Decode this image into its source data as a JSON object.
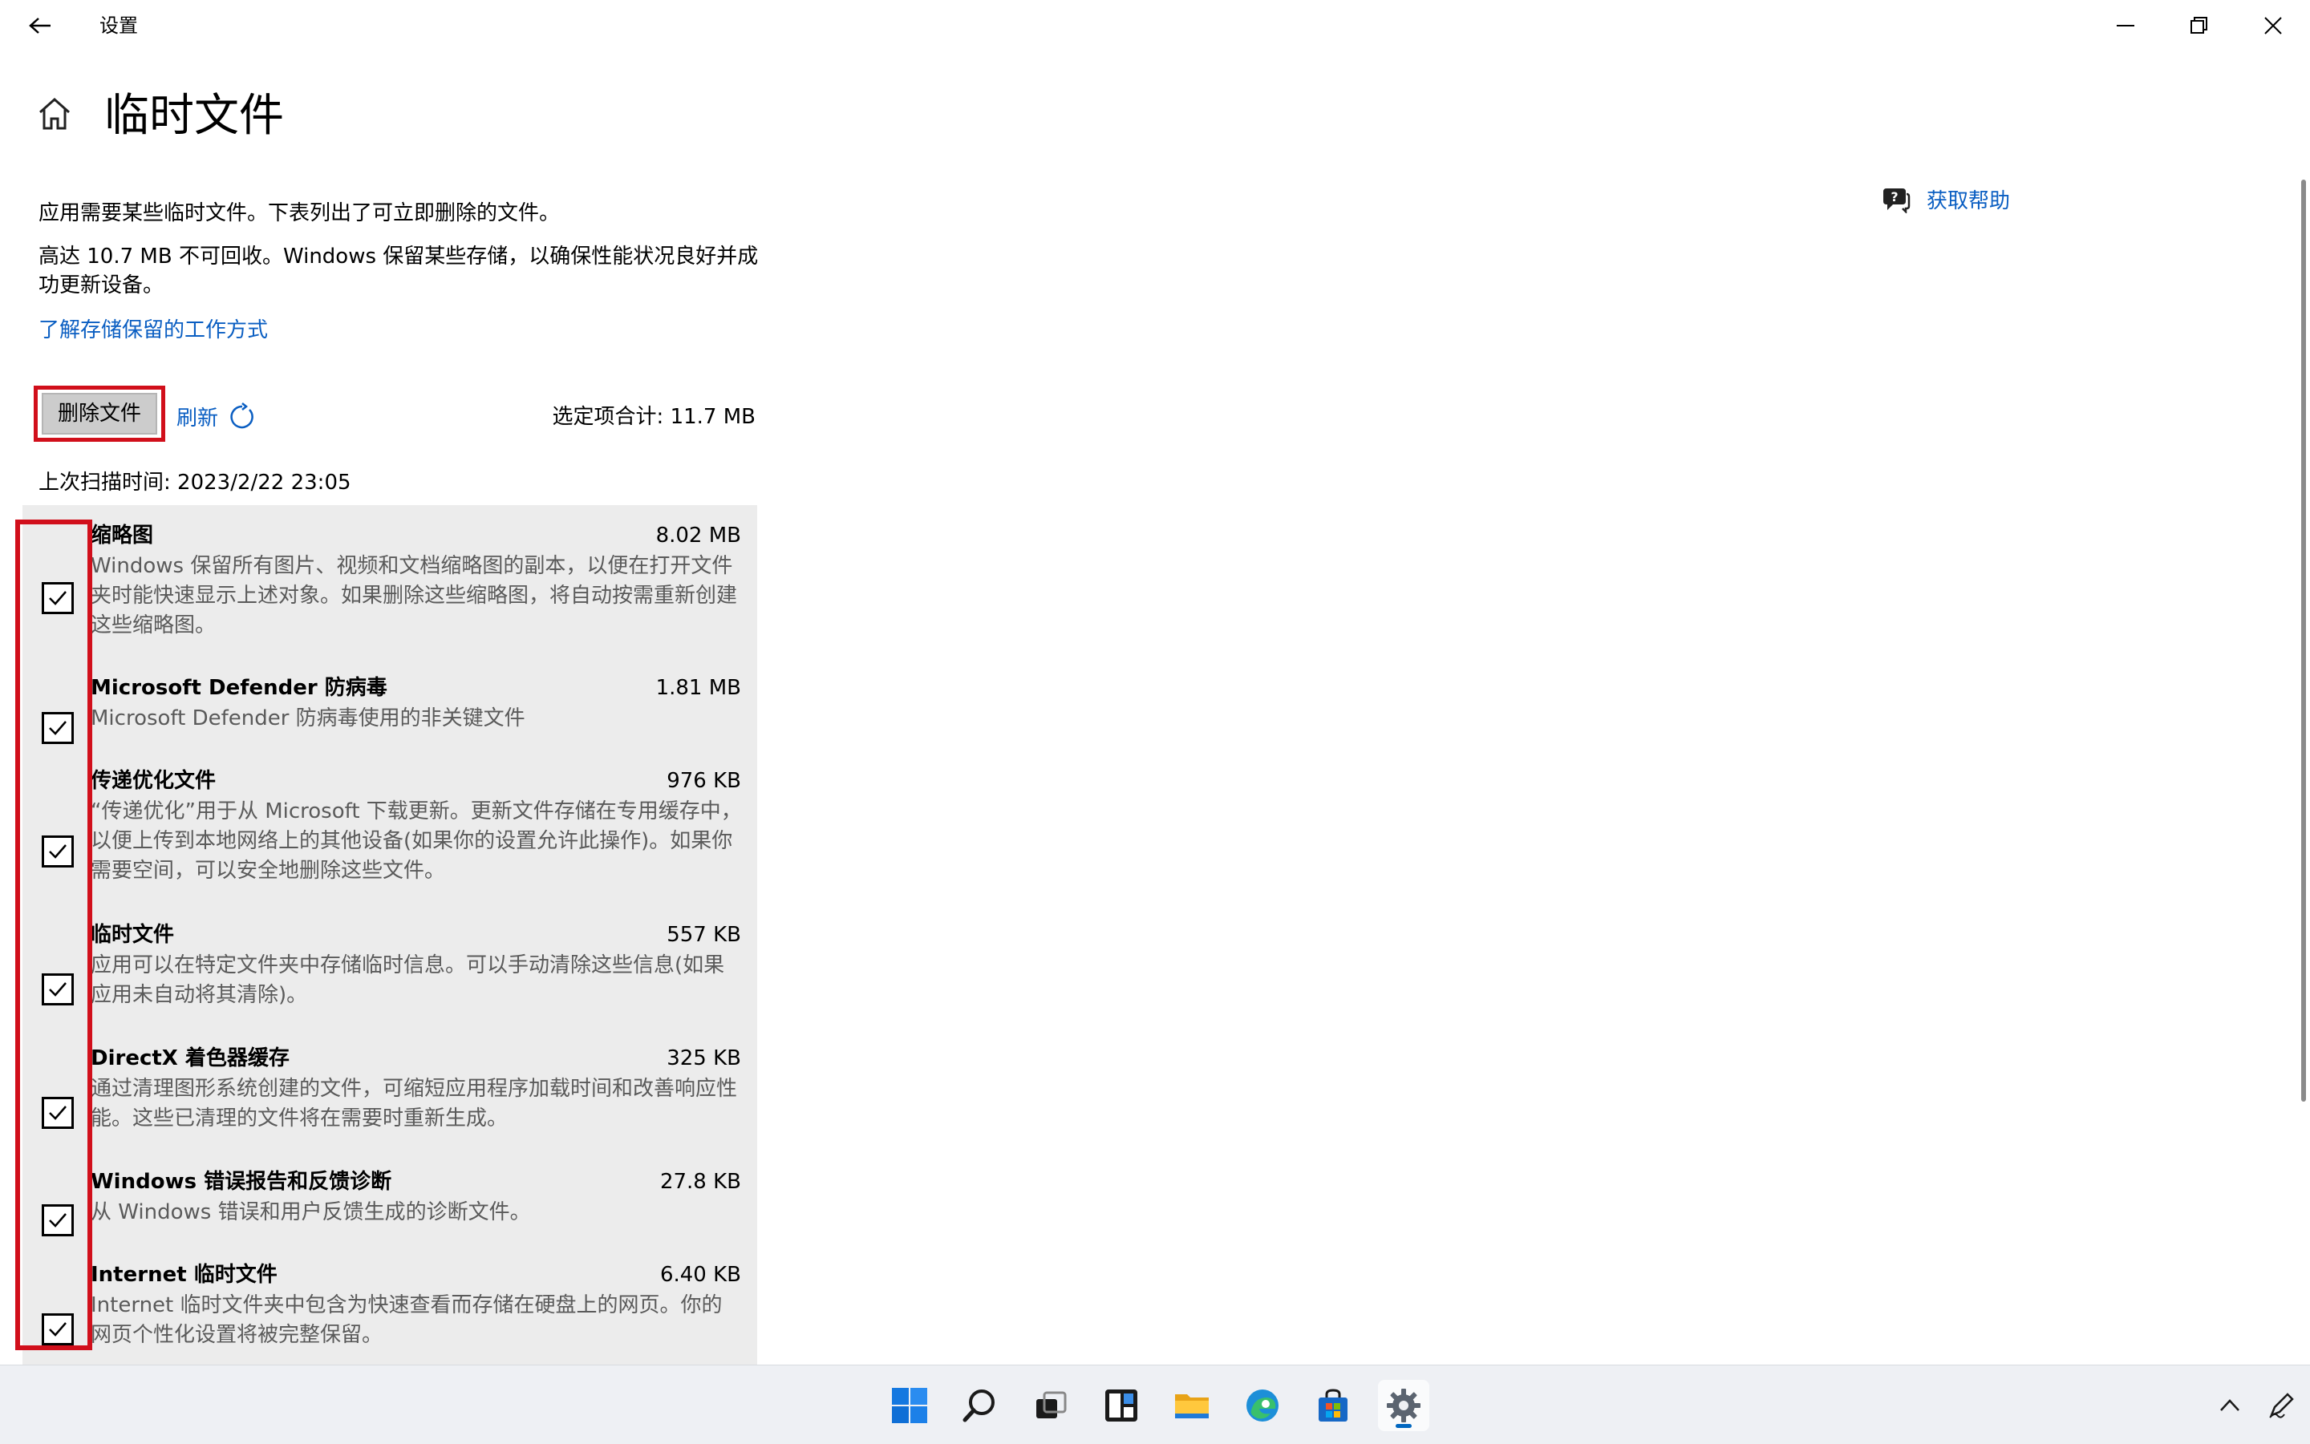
{
  "window": {
    "title": "设置"
  },
  "page": {
    "title": "临时文件",
    "help_label": "获取帮助",
    "description_1": "应用需要某些临时文件。下表列出了可立即删除的文件。",
    "description_2": "高达 10.7 MB 不可回收。Windows 保留某些存储，以确保性能状况良好并成功更新设备。",
    "learn_link": "了解存储保留的工作方式",
    "delete_button": "删除文件",
    "refresh_label": "刷新",
    "selected_total": "选定项合计: 11.7 MB",
    "last_scan": "上次扫描时间: 2023/2/22 23:05"
  },
  "items": [
    {
      "title": "缩略图",
      "size": "8.02 MB",
      "checked": true,
      "description": "Windows 保留所有图片、视频和文档缩略图的副本，以便在打开文件夹时能快速显示上述对象。如果删除这些缩略图，将自动按需重新创建这些缩略图。"
    },
    {
      "title": "Microsoft Defender 防病毒",
      "size": "1.81 MB",
      "checked": true,
      "description": "Microsoft Defender 防病毒使用的非关键文件"
    },
    {
      "title": "传递优化文件",
      "size": "976 KB",
      "checked": true,
      "description": "“传递优化”用于从 Microsoft 下载更新。更新文件存储在专用缓存中，以便上传到本地网络上的其他设备(如果你的设置允许此操作)。如果你需要空间，可以安全地删除这些文件。"
    },
    {
      "title": "临时文件",
      "size": "557 KB",
      "checked": true,
      "description": "应用可以在特定文件夹中存储临时信息。可以手动清除这些信息(如果应用未自动将其清除)。"
    },
    {
      "title": "DirectX 着色器缓存",
      "size": "325 KB",
      "checked": true,
      "description": "通过清理图形系统创建的文件，可缩短应用程序加载时间和改善响应性能。这些已清理的文件将在需要时重新生成。"
    },
    {
      "title": "Windows 错误报告和反馈诊断",
      "size": "27.8 KB",
      "checked": true,
      "description": "从 Windows 错误和用户反馈生成的诊断文件。"
    },
    {
      "title": "Internet 临时文件",
      "size": "6.40 KB",
      "checked": true,
      "description": "Internet 临时文件夹中包含为快速查看而存储在硬盘上的网页。你的网页个性化设置将被完整保留。"
    }
  ],
  "taskbar": {
    "apps": [
      "start-icon",
      "search-icon",
      "task-view-icon",
      "widgets-icon",
      "file-explorer-icon",
      "edge-icon",
      "store-icon",
      "settings-icon"
    ],
    "active": "settings-icon"
  },
  "colors": {
    "accent": "#0a5ec2",
    "highlight_red": "#d10f1b",
    "list_bg": "#ececec"
  }
}
